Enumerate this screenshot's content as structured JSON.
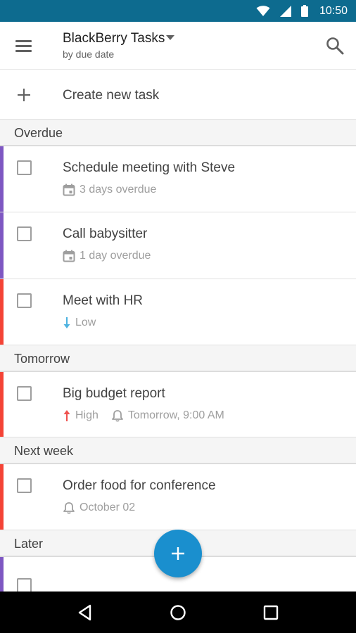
{
  "status_bar": {
    "time": "10:50"
  },
  "app_bar": {
    "title": "BlackBerry Tasks",
    "subtitle": "by due date"
  },
  "create": {
    "label": "Create new task"
  },
  "sections": [
    {
      "title": "Overdue",
      "tasks": [
        {
          "title": "Schedule meeting with Steve",
          "meta": "3 days overdue",
          "meta_icon": "calendar-icon",
          "color": "#7e57c2"
        },
        {
          "title": "Call babysitter",
          "meta": "1 day overdue",
          "meta_icon": "calendar-icon",
          "color": "#7e57c2"
        },
        {
          "title": "Meet with HR",
          "meta": "Low",
          "meta_icon": "arrow-down-icon",
          "color": "#f44336"
        }
      ]
    },
    {
      "title": "Tomorrow",
      "tasks": [
        {
          "title": "Big budget report",
          "meta": "High",
          "meta_icon": "arrow-up-icon",
          "reminder": "Tomorrow, 9:00 AM",
          "color": "#f44336"
        }
      ]
    },
    {
      "title": "Next week",
      "tasks": [
        {
          "title": "Order food for conference",
          "meta": "October 02",
          "meta_icon": "bell-icon",
          "color": "#f44336"
        }
      ]
    },
    {
      "title": "Later",
      "tasks": [
        {
          "title": "",
          "color": "#7e57c2"
        }
      ]
    }
  ],
  "colors": {
    "status_bar": "#0d6b8f",
    "fab": "#1a8fce",
    "low_arrow": "#4fb3e0",
    "high_arrow": "#ef5350"
  }
}
